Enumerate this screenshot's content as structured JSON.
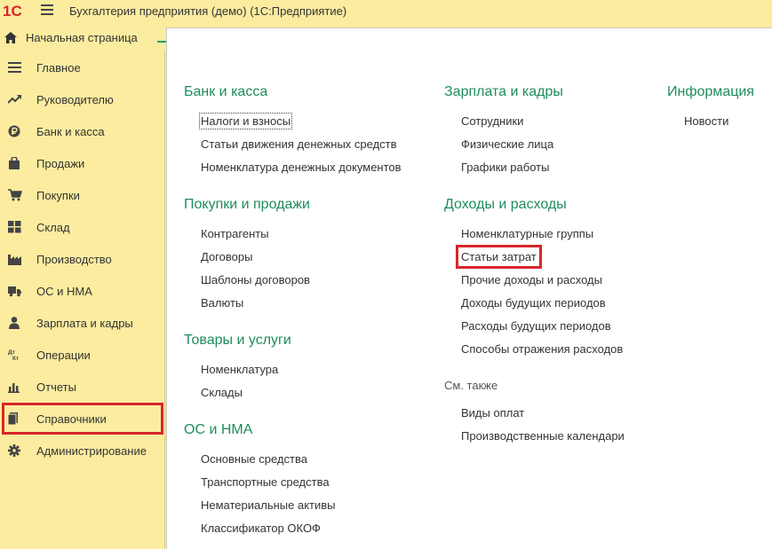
{
  "app": {
    "logo": "1С",
    "title": "Бухгалтерия предприятия (демо)  (1С:Предприятие)",
    "home_label": "Начальная страница"
  },
  "sidebar": {
    "items": [
      {
        "label": "Главное",
        "icon": "menu-lines-icon"
      },
      {
        "label": "Руководителю",
        "icon": "trend-icon"
      },
      {
        "label": "Банк и касса",
        "icon": "ruble-coin-icon"
      },
      {
        "label": "Продажи",
        "icon": "shopping-bag-icon"
      },
      {
        "label": "Покупки",
        "icon": "cart-icon"
      },
      {
        "label": "Склад",
        "icon": "warehouse-icon"
      },
      {
        "label": "Производство",
        "icon": "factory-icon"
      },
      {
        "label": "ОС и НМА",
        "icon": "truck-icon"
      },
      {
        "label": "Зарплата и кадры",
        "icon": "person-icon"
      },
      {
        "label": "Операции",
        "icon": "dt-kt-icon"
      },
      {
        "label": "Отчеты",
        "icon": "bar-chart-icon"
      },
      {
        "label": "Справочники",
        "icon": "books-icon"
      },
      {
        "label": "Администрирование",
        "icon": "gear-icon"
      }
    ],
    "dt_glyph": "Дт",
    "kt_glyph": "Кт"
  },
  "main": {
    "col1": {
      "bank": {
        "title": "Банк и касса",
        "links": [
          "Налоги и взносы",
          "Статьи движения денежных средств",
          "Номенклатура денежных документов"
        ]
      },
      "buysell": {
        "title": "Покупки и продажи",
        "links": [
          "Контрагенты",
          "Договоры",
          "Шаблоны договоров",
          "Валюты"
        ]
      },
      "goods": {
        "title": "Товары и услуги",
        "links": [
          "Номенклатура",
          "Склады"
        ]
      },
      "os": {
        "title": "ОС и НМА",
        "links": [
          "Основные средства",
          "Транспортные средства",
          "Нематериальные активы",
          "Классификатор ОКОФ"
        ]
      }
    },
    "col2": {
      "salary": {
        "title": "Зарплата и кадры",
        "links": [
          "Сотрудники",
          "Физические лица",
          "Графики работы"
        ]
      },
      "income": {
        "title": "Доходы и расходы",
        "links": [
          "Номенклатурные группы",
          "Статьи затрат",
          "Прочие доходы и расходы",
          "Доходы будущих периодов",
          "Расходы будущих периодов",
          "Способы отражения расходов"
        ]
      },
      "see_also": {
        "title": "См. также",
        "links": [
          "Виды оплат",
          "Производственные календари"
        ]
      }
    },
    "col3": {
      "info": {
        "title": "Информация",
        "links": [
          "Новости"
        ]
      }
    }
  },
  "colors": {
    "accent_green": "#1e8c5c",
    "sidebar_bg": "#fbeca0",
    "highlight_red": "#d8262a"
  }
}
